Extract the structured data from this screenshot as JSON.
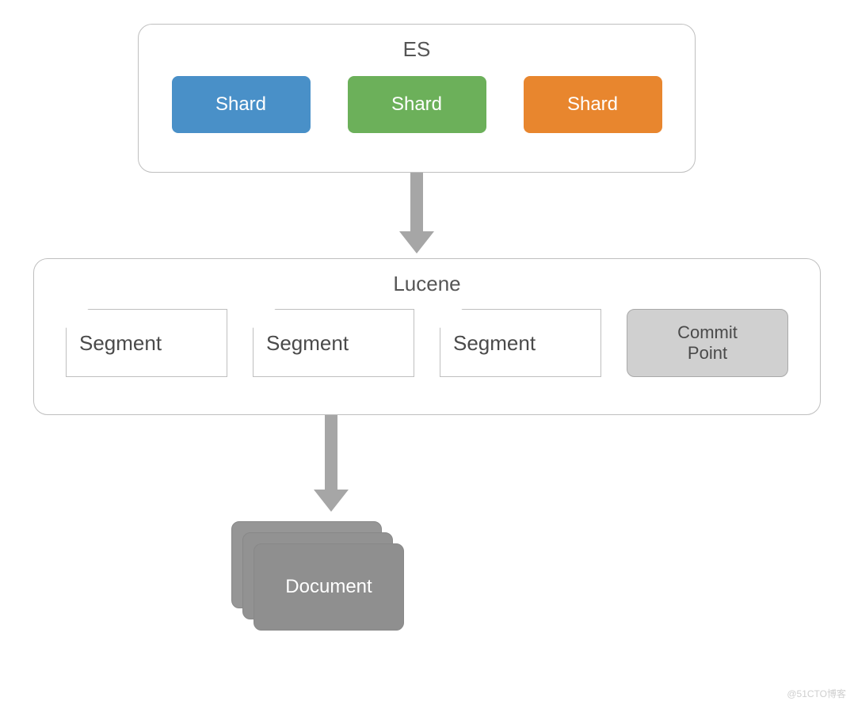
{
  "es": {
    "title": "ES",
    "shards": [
      "Shard",
      "Shard",
      "Shard"
    ]
  },
  "lucene": {
    "title": "Lucene",
    "segments": [
      "Segment",
      "Segment",
      "Segment"
    ],
    "commit_point": "Commit\nPoint"
  },
  "document": {
    "label": "Document"
  },
  "watermark": "@51CTO博客",
  "colors": {
    "shard_blue": "#4990c8",
    "shard_green": "#6cb05a",
    "shard_orange": "#e8862e",
    "arrow": "#a6a6a6",
    "commit_bg": "#d0d0d0",
    "doc_bg": "#8f8f8f"
  }
}
